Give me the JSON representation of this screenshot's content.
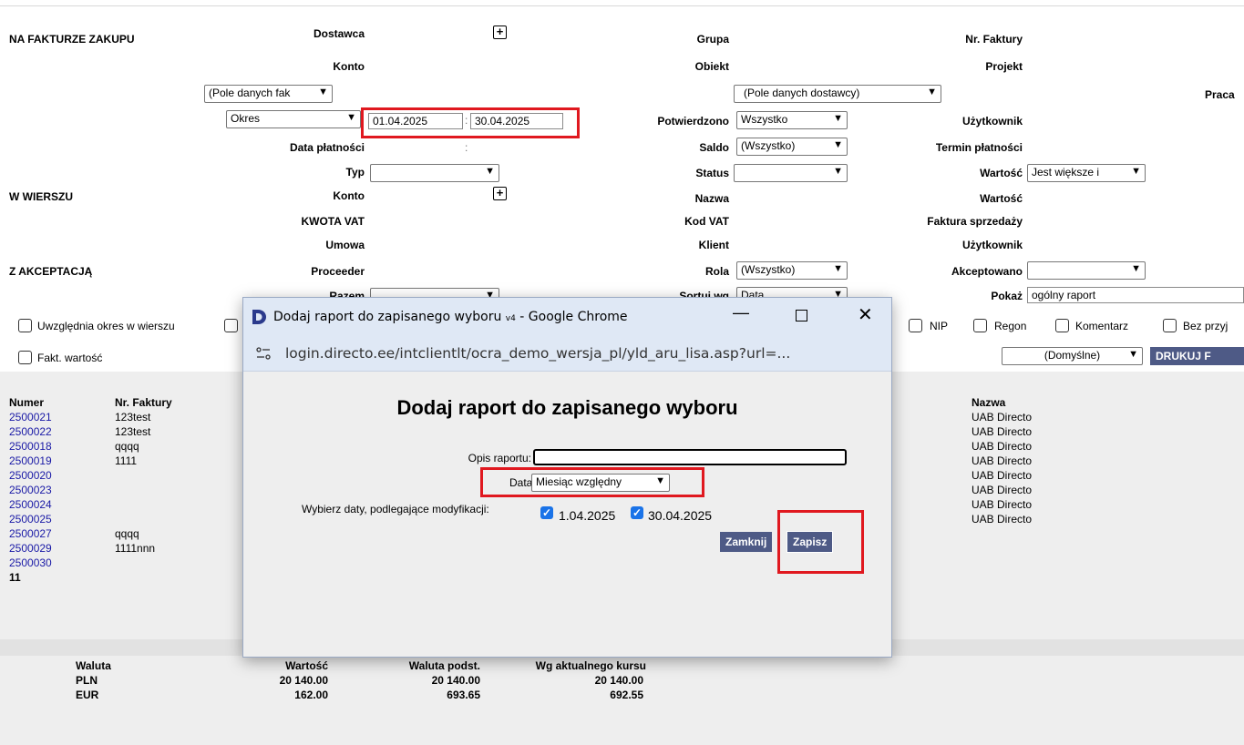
{
  "filters": {
    "section_na_fakturze": "NA FAKTURZE ZAKUPU",
    "section_w_wierszu": "W WIERSZU",
    "section_z_akceptacja": "Z AKCEPTACJĄ",
    "dostawca": "Dostawca",
    "konto": "Konto",
    "pole_danych_fak": "(Pole danych fak",
    "okres": "Okres",
    "date_from": "01.04.2025",
    "date_to": "30.04.2025",
    "range_sep": ":",
    "data_platnosci": "Data płatności",
    "typ": "Typ",
    "konto2": "Konto",
    "kwota_vat": "KWOTA VAT",
    "umowa": "Umowa",
    "proceeder": "Proceeder",
    "razem": "Razem",
    "grupa": "Grupa",
    "obiekt": "Obiekt",
    "pole_danych_dostawcy": "(Pole danych dostawcy)",
    "potwierdzono": "Potwierdzono",
    "potwierdzono_val": "Wszystko",
    "saldo": "Saldo",
    "saldo_val": "(Wszystko)",
    "status": "Status",
    "nazwa": "Nazwa",
    "kod_vat": "Kod VAT",
    "klient": "Klient",
    "rola": "Rola",
    "rola_val": "(Wszystko)",
    "sortuj": "Sortuj wg",
    "sortuj_val": "Data",
    "nr_faktury": "Nr. Faktury",
    "projekt": "Projekt",
    "praca": "Praca",
    "uzytkownik": "Użytkownik",
    "termin_platnosci": "Termin płatności",
    "wartosc": "Wartość",
    "wartosc_val": "Jest większe i",
    "wartosc2": "Wartość",
    "faktura_sprzedazy": "Faktura sprzedaży",
    "uzytkownik2": "Użytkownik",
    "akceptowano": "Akceptowano",
    "pokaz": "Pokaż",
    "pokaz_val": "ogólny raport",
    "uwzglednia": "Uwzględnia okres w wierszu",
    "fakt_wartosc": "Fakt. wartość",
    "nip": "NIP",
    "regon": "Regon",
    "komentarz": "Komentarz",
    "bez_przyj": "Bez przyj",
    "domyslne": "(Domyślne)",
    "drukuj": "DRUKUJ F"
  },
  "results": {
    "headers": {
      "numer": "Numer",
      "nr_faktury": "Nr. Faktury",
      "nazwa": "Nazwa"
    },
    "rows": [
      {
        "numer": "2500021",
        "nr_faktury": "123test",
        "nazwa": "UAB Directo"
      },
      {
        "numer": "2500022",
        "nr_faktury": "123test",
        "nazwa": "UAB Directo"
      },
      {
        "numer": "2500018",
        "nr_faktury": "qqqq",
        "nazwa": "UAB Directo"
      },
      {
        "numer": "2500019",
        "nr_faktury": "1111",
        "nazwa": "UAB Directo"
      },
      {
        "numer": "2500020",
        "nr_faktury": "",
        "nazwa": "UAB Directo"
      },
      {
        "numer": "2500023",
        "nr_faktury": "",
        "nazwa": "UAB Directo"
      },
      {
        "numer": "2500024",
        "nr_faktury": "qqqq",
        "nazwa": "UAB Directo"
      },
      {
        "numer": "2500025",
        "nr_faktury": "1111nnn",
        "nazwa": "UAB Directo"
      },
      {
        "numer": "2500027",
        "nr_faktury": "",
        "nazwa": ""
      },
      {
        "numer": "2500029",
        "nr_faktury": "",
        "nazwa": ""
      },
      {
        "numer": "2500030",
        "nr_faktury": "",
        "nazwa": ""
      }
    ],
    "count": "11"
  },
  "summary": {
    "headers": [
      "Waluta",
      "Wartość",
      "Waluta podst.",
      "Wg aktualnego kursu"
    ],
    "rows": [
      [
        "PLN",
        "20 140.00",
        "20 140.00",
        "20 140.00"
      ],
      [
        "EUR",
        "162.00",
        "693.65",
        "692.55"
      ]
    ]
  },
  "popup": {
    "window_title": "Dodaj raport do zapisanego wyboru",
    "window_title_sub": "v4",
    "window_title_app": "- Google Chrome",
    "url": "login.directo.ee/intclientlt/ocra_demo_wersja_pl/yld_aru_lisa.asp?url=...",
    "heading": "Dodaj raport do zapisanego wyboru",
    "opis_label": "Opis raportu:",
    "data_label": "Data:",
    "data_value": "Miesiąc względny",
    "wybierz_label": "Wybierz daty, podlegające modyfikacji:",
    "date1": "1.04.2025",
    "date2": "30.04.2025",
    "zamknij": "Zamknij",
    "zapisz": "Zapisz"
  },
  "colors": {
    "highlight": "#e0181f",
    "button": "#4e5a86",
    "link": "#1a1aa6"
  }
}
